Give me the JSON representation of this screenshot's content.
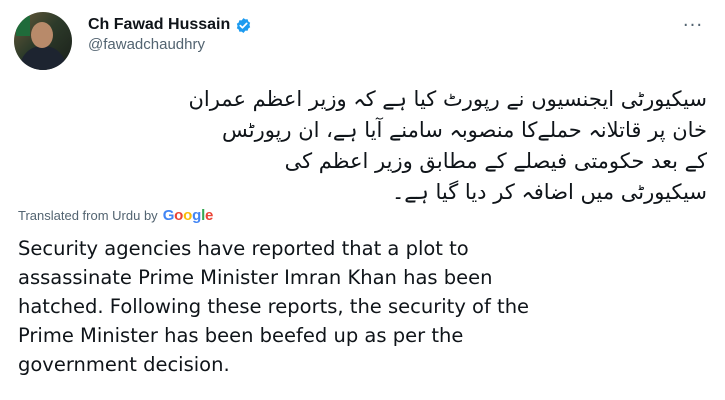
{
  "tweet": {
    "author_name": "Ch Fawad Hussain",
    "handle": "@fawadchaudhry",
    "more_glyph": "···",
    "urdu_lines": [
      "سیکیورٹی ایجنسیوں نے رپورٹ کیا ہے کہ وزیر اعظم عمران",
      "خان پر قاتلانہ حملےکا منصوبہ سامنے آیا ہے، ان رپورٹس",
      "کے بعد حکومتی فیصلے کے مطابق وزیر اعظم کی",
      "سیکیورٹی میں اضافہ کر دیا گیا ہے۔"
    ],
    "translated_from": "Translated from Urdu by",
    "translation_provider": "Google",
    "translation_lines": [
      "Security agencies have reported that a plot to",
      "assassinate Prime Minister Imran Khan has been",
      "hatched. Following these reports, the security of the",
      "Prime Minister has been beefed up as per the",
      "government decision."
    ]
  },
  "icons": {
    "verified": "verified-badge-icon",
    "more": "more-options-icon"
  },
  "colors": {
    "verified_blue": "#1d9bf0",
    "secondary_text": "#536471",
    "primary_text": "#0f1419"
  }
}
